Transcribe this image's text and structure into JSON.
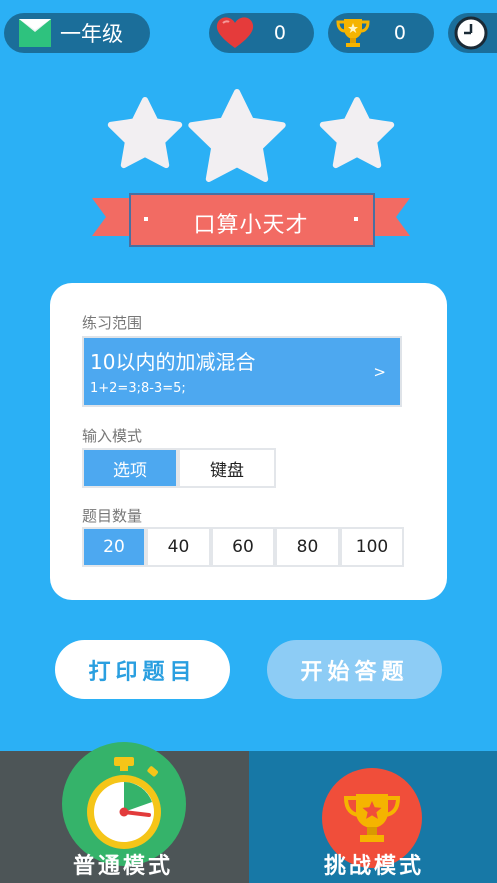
{
  "header": {
    "grade_label": "一年级",
    "hearts_count": "0",
    "trophies_count": "0"
  },
  "title_banner": "口算小天才",
  "practice_range": {
    "label": "练习范围",
    "title": "10以内的加减混合",
    "example": "1+2=3;8-3=5;",
    "arrow": ">"
  },
  "input_mode": {
    "label": "输入模式",
    "options": [
      "选项",
      "键盘"
    ],
    "selected": "选项"
  },
  "question_count": {
    "label": "题目数量",
    "options": [
      "20",
      "40",
      "60",
      "80",
      "100"
    ],
    "selected": "20"
  },
  "actions": {
    "print_label": "打印题目",
    "start_label": "开始答题"
  },
  "modes": {
    "normal_label": "普通模式",
    "challenge_label": "挑战模式"
  },
  "colors": {
    "background": "#2bb0f5",
    "header_pill": "#1b6e9a",
    "selected": "#4da8f0",
    "banner": "#f26b63",
    "normal_mode_bg": "#4d5557",
    "challenge_mode_bg": "#1778a6"
  },
  "icons": [
    "mail-icon",
    "heart-icon",
    "trophy-icon",
    "clock-icon",
    "star-icon",
    "stopwatch-icon",
    "trophy-badge-icon"
  ]
}
